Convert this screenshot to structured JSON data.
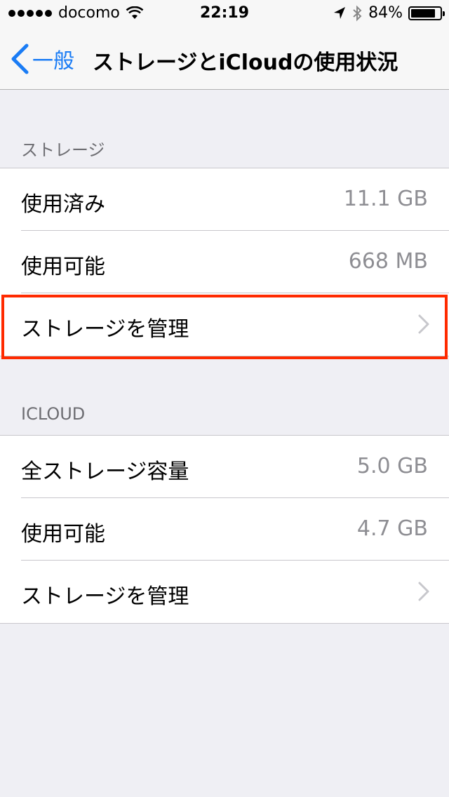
{
  "status_bar": {
    "carrier": "docomo",
    "time": "22:19",
    "battery_percent": "84%",
    "battery_level": 0.84,
    "icons": [
      "signal-dots-icon",
      "wifi-icon",
      "location-arrow-icon",
      "bluetooth-icon",
      "battery-icon"
    ]
  },
  "nav": {
    "back_label": "一般",
    "title": "ストレージとiCloudの使用状況"
  },
  "storage": {
    "header": "ストレージ",
    "rows": [
      {
        "label": "使用済み",
        "value": "11.1 GB"
      },
      {
        "label": "使用可能",
        "value": "668 MB"
      },
      {
        "label": "ストレージを管理"
      }
    ]
  },
  "icloud": {
    "header": "ICLOUD",
    "rows": [
      {
        "label": "全ストレージ容量",
        "value": "5.0 GB"
      },
      {
        "label": "使用可能",
        "value": "4.7 GB"
      },
      {
        "label": "ストレージを管理"
      }
    ]
  },
  "colors": {
    "accent": "#1a7cf5",
    "highlight": "#ff2a00",
    "background": "#efeff4",
    "secondary_text": "#8e8e93"
  }
}
